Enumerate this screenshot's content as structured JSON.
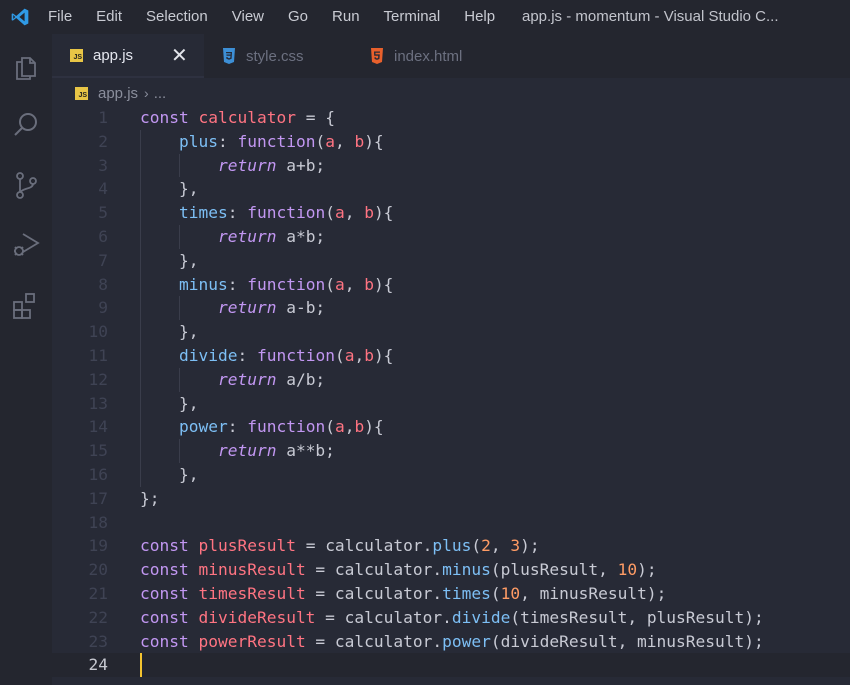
{
  "menu": [
    "File",
    "Edit",
    "Selection",
    "View",
    "Go",
    "Run",
    "Terminal",
    "Help"
  ],
  "window_title": "app.js - momentum - Visual Studio C...",
  "tabs": [
    {
      "label": "app.js",
      "icon": "js-file-icon",
      "active": true
    },
    {
      "label": "style.css",
      "icon": "css-file-icon",
      "active": false
    },
    {
      "label": "index.html",
      "icon": "html-file-icon",
      "active": false
    }
  ],
  "breadcrumb": {
    "file": "app.js",
    "rest": "..."
  },
  "activity_icons": [
    "explorer-icon",
    "search-icon",
    "source-control-icon",
    "run-debug-icon",
    "extensions-icon"
  ],
  "colors": {
    "background": "#272a36",
    "chrome": "#24262f",
    "keyword": "#c297f2",
    "variable": "#ff7482",
    "property": "#7dbff5",
    "number": "#ff9c65",
    "cursor": "#f4c430"
  },
  "editor": {
    "current_line": 24,
    "lines": [
      {
        "n": "1",
        "tokens": [
          [
            "kw",
            "const "
          ],
          [
            "var",
            "calculator"
          ],
          [
            "plain",
            " = {"
          ]
        ]
      },
      {
        "n": "2",
        "tokens": [
          [
            "plain",
            "    "
          ],
          [
            "prop",
            "plus"
          ],
          [
            "plain",
            ": "
          ],
          [
            "fn",
            "function"
          ],
          [
            "plain",
            "("
          ],
          [
            "param",
            "a"
          ],
          [
            "plain",
            ", "
          ],
          [
            "param",
            "b"
          ],
          [
            "plain",
            "){"
          ]
        ]
      },
      {
        "n": "3",
        "tokens": [
          [
            "plain",
            "        "
          ],
          [
            "ret",
            "return"
          ],
          [
            "plain",
            " a+b;"
          ]
        ]
      },
      {
        "n": "4",
        "tokens": [
          [
            "plain",
            "    },"
          ]
        ]
      },
      {
        "n": "5",
        "tokens": [
          [
            "plain",
            "    "
          ],
          [
            "prop",
            "times"
          ],
          [
            "plain",
            ": "
          ],
          [
            "fn",
            "function"
          ],
          [
            "plain",
            "("
          ],
          [
            "param",
            "a"
          ],
          [
            "plain",
            ", "
          ],
          [
            "param",
            "b"
          ],
          [
            "plain",
            "){"
          ]
        ]
      },
      {
        "n": "6",
        "tokens": [
          [
            "plain",
            "        "
          ],
          [
            "ret",
            "return"
          ],
          [
            "plain",
            " a*b;"
          ]
        ]
      },
      {
        "n": "7",
        "tokens": [
          [
            "plain",
            "    },"
          ]
        ]
      },
      {
        "n": "8",
        "tokens": [
          [
            "plain",
            "    "
          ],
          [
            "prop",
            "minus"
          ],
          [
            "plain",
            ": "
          ],
          [
            "fn",
            "function"
          ],
          [
            "plain",
            "("
          ],
          [
            "param",
            "a"
          ],
          [
            "plain",
            ", "
          ],
          [
            "param",
            "b"
          ],
          [
            "plain",
            "){"
          ]
        ]
      },
      {
        "n": "9",
        "tokens": [
          [
            "plain",
            "        "
          ],
          [
            "ret",
            "return"
          ],
          [
            "plain",
            " a-b;"
          ]
        ]
      },
      {
        "n": "10",
        "tokens": [
          [
            "plain",
            "    },"
          ]
        ]
      },
      {
        "n": "11",
        "tokens": [
          [
            "plain",
            "    "
          ],
          [
            "prop",
            "divide"
          ],
          [
            "plain",
            ": "
          ],
          [
            "fn",
            "function"
          ],
          [
            "plain",
            "("
          ],
          [
            "param",
            "a"
          ],
          [
            "plain",
            ","
          ],
          [
            "param",
            "b"
          ],
          [
            "plain",
            "){"
          ]
        ]
      },
      {
        "n": "12",
        "tokens": [
          [
            "plain",
            "        "
          ],
          [
            "ret",
            "return"
          ],
          [
            "plain",
            " a/b;"
          ]
        ]
      },
      {
        "n": "13",
        "tokens": [
          [
            "plain",
            "    },"
          ]
        ]
      },
      {
        "n": "14",
        "tokens": [
          [
            "plain",
            "    "
          ],
          [
            "prop",
            "power"
          ],
          [
            "plain",
            ": "
          ],
          [
            "fn",
            "function"
          ],
          [
            "plain",
            "("
          ],
          [
            "param",
            "a"
          ],
          [
            "plain",
            ","
          ],
          [
            "param",
            "b"
          ],
          [
            "plain",
            "){"
          ]
        ]
      },
      {
        "n": "15",
        "tokens": [
          [
            "plain",
            "        "
          ],
          [
            "ret",
            "return"
          ],
          [
            "plain",
            " a**b;"
          ]
        ]
      },
      {
        "n": "16",
        "tokens": [
          [
            "plain",
            "    },"
          ]
        ]
      },
      {
        "n": "17",
        "tokens": [
          [
            "plain",
            "};"
          ]
        ]
      },
      {
        "n": "18",
        "tokens": []
      },
      {
        "n": "19",
        "tokens": [
          [
            "kw",
            "const "
          ],
          [
            "var",
            "plusResult"
          ],
          [
            "plain",
            " = calculator."
          ],
          [
            "method",
            "plus"
          ],
          [
            "plain",
            "("
          ],
          [
            "num",
            "2"
          ],
          [
            "plain",
            ", "
          ],
          [
            "num",
            "3"
          ],
          [
            "plain",
            ");"
          ]
        ]
      },
      {
        "n": "20",
        "tokens": [
          [
            "kw",
            "const "
          ],
          [
            "var",
            "minusResult"
          ],
          [
            "plain",
            " = calculator."
          ],
          [
            "method",
            "minus"
          ],
          [
            "plain",
            "(plusResult, "
          ],
          [
            "num",
            "10"
          ],
          [
            "plain",
            ");"
          ]
        ]
      },
      {
        "n": "21",
        "tokens": [
          [
            "kw",
            "const "
          ],
          [
            "var",
            "timesResult"
          ],
          [
            "plain",
            " = calculator."
          ],
          [
            "method",
            "times"
          ],
          [
            "plain",
            "("
          ],
          [
            "num",
            "10"
          ],
          [
            "plain",
            ", minusResult);"
          ]
        ]
      },
      {
        "n": "22",
        "tokens": [
          [
            "kw",
            "const "
          ],
          [
            "var",
            "divideResult"
          ],
          [
            "plain",
            " = calculator."
          ],
          [
            "method",
            "divide"
          ],
          [
            "plain",
            "(timesResult, plusResult);"
          ]
        ]
      },
      {
        "n": "23",
        "tokens": [
          [
            "kw",
            "const "
          ],
          [
            "var",
            "powerResult"
          ],
          [
            "plain",
            " = calculator."
          ],
          [
            "method",
            "power"
          ],
          [
            "plain",
            "(divideResult, minusResult);"
          ]
        ]
      },
      {
        "n": "24",
        "tokens": []
      }
    ]
  }
}
